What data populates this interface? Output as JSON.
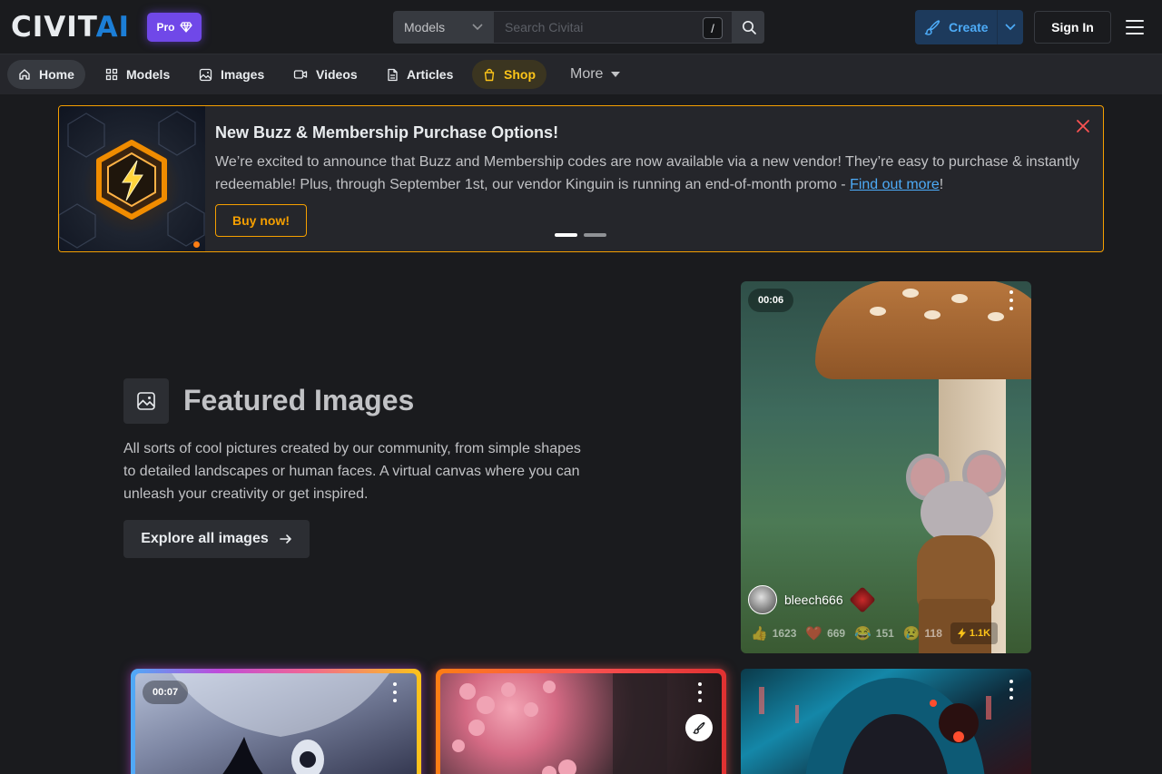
{
  "header": {
    "logo_main": "CIVIT",
    "logo_accent": "AI",
    "pro_label": "Pro",
    "search_type": "Models",
    "search_placeholder": "Search Civitai",
    "search_shortcut": "/",
    "create_label": "Create",
    "signin_label": "Sign In"
  },
  "nav": {
    "items": [
      {
        "label": "Home",
        "icon": "home-icon"
      },
      {
        "label": "Models",
        "icon": "grid-icon"
      },
      {
        "label": "Images",
        "icon": "image-icon"
      },
      {
        "label": "Videos",
        "icon": "video-icon"
      },
      {
        "label": "Articles",
        "icon": "document-icon"
      },
      {
        "label": "Shop",
        "icon": "shopping-bag-icon"
      }
    ],
    "more_label": "More",
    "active": "Home"
  },
  "banner": {
    "title": "New Buzz & Membership Purchase Options!",
    "text": "We’re excited to announce that Buzz and Membership codes are now available via a new vendor! They’re easy to purchase & instantly redeemable! Plus, through September 1st, our vendor Kinguin is running an end-of-month promo - ",
    "link_text": "Find out more",
    "text_end": "!",
    "button_label": "Buy now!",
    "slide_count": 2,
    "active_slide": 1
  },
  "featured": {
    "title": "Featured Images",
    "description": "All sorts of cool pictures created by our community, from simple shapes to detailed landscapes or human faces. A virtual canvas where you can unleash your creativity or get inspired.",
    "button_label": "Explore all images"
  },
  "cards": {
    "main": {
      "duration": "00:06",
      "username": "bleech666",
      "reactions": {
        "like": "1623",
        "heart": "669",
        "laugh": "151",
        "cry": "118",
        "buzz": "1.1K"
      }
    },
    "second": {
      "duration": "00:07"
    }
  },
  "colors": {
    "background": "#1a1b1e",
    "accent_blue": "#1c7ed6",
    "pro_purple": "#7048e8",
    "shop_yellow": "#fcc419",
    "banner_border": "#f59f00"
  }
}
